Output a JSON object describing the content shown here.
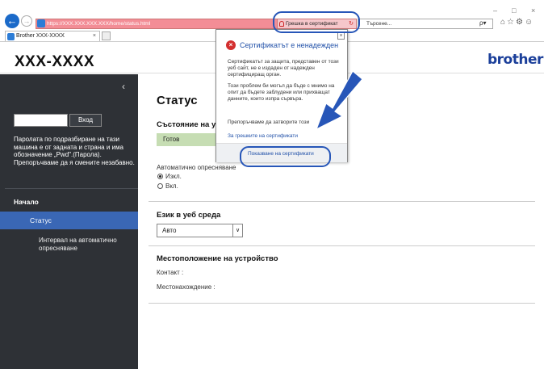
{
  "browser": {
    "address_url": "https://XXX.XXX.XXX.XXX/home/status.html",
    "cert_error_label": "Грешка в сертификат",
    "search_placeholder": "Търсене...",
    "search_btn": "ρ▾",
    "toolbar_icons": "⌂☆⚙☺",
    "win_minimize": "–",
    "win_maximize": "□",
    "win_close": "×",
    "tab_label": "Brother XXX-XXXX",
    "tab_close": "×",
    "back_icon": "←",
    "forward_icon": "→",
    "reload_icon": "↻"
  },
  "header": {
    "model": "XXX-XXXX",
    "brand": "brother"
  },
  "sidebar": {
    "collapse": "‹",
    "login_button": "Вход",
    "password_note": "Паролата по подразбиране на тази машина е от задната и страна и има обозначение „Pwd\".(Парола). Препоръчваме да я смените незабавно.",
    "home": "Начало",
    "items": [
      {
        "label": "Статус",
        "active": true
      },
      {
        "label": "Интервал на автоматично опресняване",
        "active": false
      }
    ]
  },
  "main": {
    "title": "Статус",
    "device_status_heading": "Състояние на ус",
    "device_status_value": "Готов",
    "auto_refresh_label": "Автоматично опресняване",
    "radio_off": "Изкл.",
    "radio_on": "Вкл.",
    "web_language_heading": "Език в уеб среда",
    "web_language_value": "Авто",
    "location_heading": "Местоположение на устройство",
    "contact_label": "Контакт :",
    "location_label": "Местонахождение :"
  },
  "popup": {
    "title": "Сертификатът е ненадежден",
    "close": "×",
    "para1": "Сертификатът за защита, представен от този уеб сайт, не е издаден от надежден сертифициращ орган.",
    "para2": "Този проблем би могъл да бъде с мнимо на опит да бъдете заблудени или прихващат данните, които изпра сървъра.",
    "para3": "Препоръчваме да затворите този",
    "link": "За грешките на сертификати",
    "show_cert": "Показване на сертификати"
  },
  "colors": {
    "addr_error": "#f38d96",
    "sidebar_bg": "#2e3136",
    "sidebar_active": "#3a67b5",
    "status_ready": "#c6ddb3",
    "callout": "#2756b8",
    "brand": "#1b3f9a"
  }
}
